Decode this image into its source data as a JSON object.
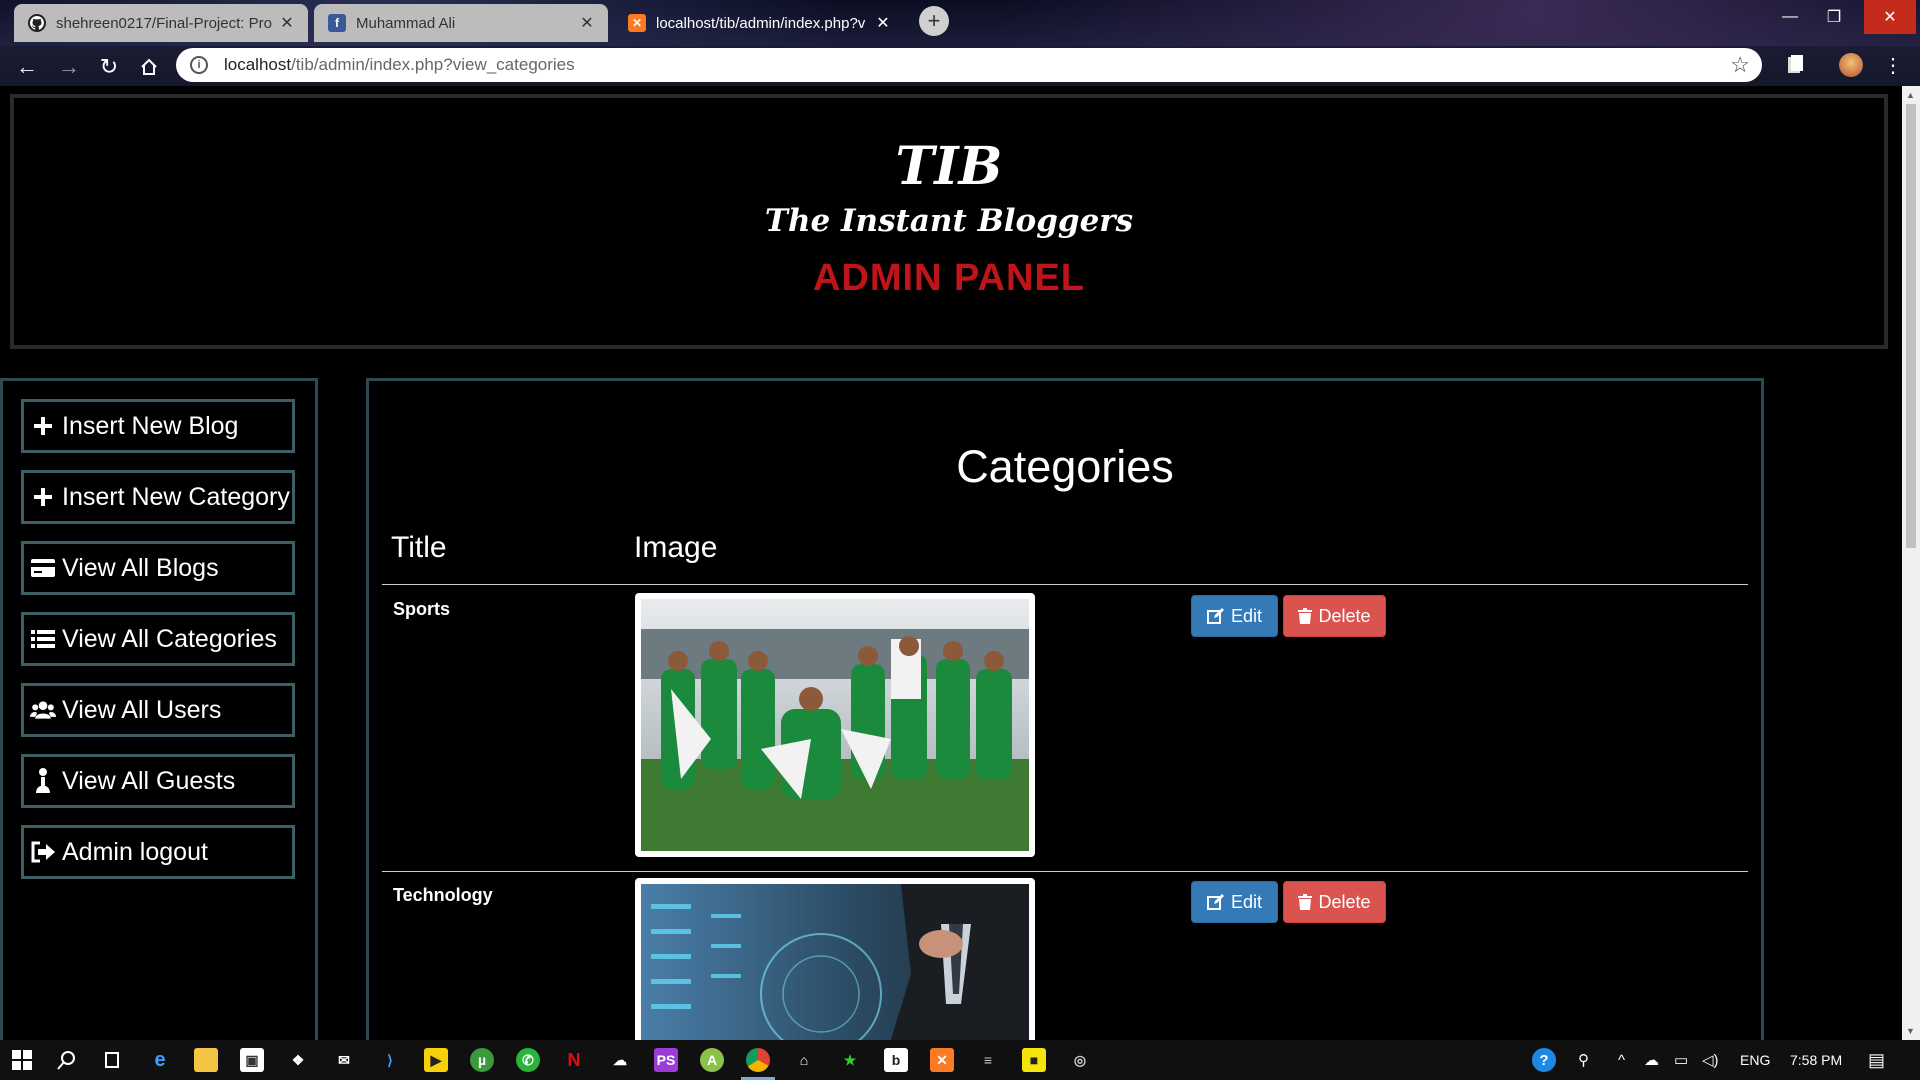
{
  "browser": {
    "tabs": [
      {
        "title": "shehreen0217/Final-Project: Pro",
        "favicon": "github-icon",
        "active": false
      },
      {
        "title": "Muhammad Ali",
        "favicon": "facebook-icon",
        "active": false
      },
      {
        "title": "localhost/tib/admin/index.php?v",
        "favicon": "xampp-icon",
        "active": true
      }
    ],
    "close_glyph": "✕",
    "url_host": "localhost",
    "url_path": "/tib/admin/index.php?view_categories"
  },
  "header": {
    "brand": "TIB",
    "tagline": "The Instant Bloggers",
    "panel": "ADMIN PANEL",
    "panel_color": "#c0141a"
  },
  "sidebar": {
    "items": [
      {
        "label": "Insert New Blog",
        "icon": "plus-icon"
      },
      {
        "label": "Insert New Category",
        "icon": "plus-icon"
      },
      {
        "label": "View All Blogs",
        "icon": "credit-card-icon"
      },
      {
        "label": "View All Categories",
        "icon": "list-icon"
      },
      {
        "label": "View All Users",
        "icon": "users-icon"
      },
      {
        "label": "View All Guests",
        "icon": "guest-icon"
      },
      {
        "label": "Admin logout",
        "icon": "logout-icon"
      }
    ]
  },
  "categories": {
    "title": "Categories",
    "columns": [
      "Title",
      "Image"
    ],
    "rows": [
      {
        "title": "Sports",
        "image": "cricket team celebrating with flags"
      },
      {
        "title": "Technology",
        "image": "server room and businessman"
      }
    ],
    "edit_label": "Edit",
    "delete_label": "Delete",
    "edit_color": "#337ab7",
    "delete_color": "#d9534f"
  },
  "taskbar": {
    "lang": "ENG",
    "time": "7:58 PM"
  }
}
